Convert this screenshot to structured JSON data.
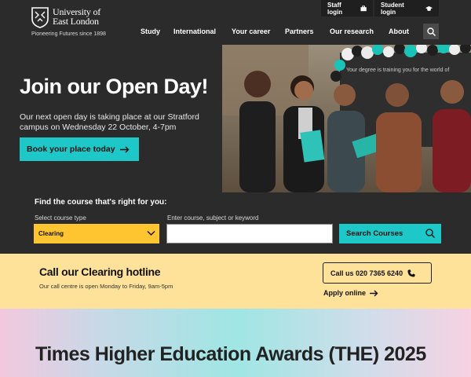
{
  "header": {
    "logo_text_line1": "University of",
    "logo_text_line2": "East London",
    "tagline": "Pioneering Futures since 1898",
    "staff_login": "Staff login",
    "student_login": "Student login",
    "nav": [
      "Study",
      "International",
      "Your career",
      "Partners",
      "Our research",
      "About"
    ]
  },
  "hero": {
    "title": "Join our Open Day!",
    "description": "Our next open day is taking place at our Stratford campus on Wednesday 22 October, 4-7pm",
    "button": "Book your place today",
    "photo_sign": "Your degree is training you for the world of"
  },
  "finder": {
    "title": "Find the course that's right for you:",
    "select_label": "Select course type",
    "select_value": "Clearing",
    "keyword_label": "Enter course, subject or keyword",
    "keyword_value": "",
    "search_button": "Search Courses"
  },
  "clearing": {
    "title": "Call our Clearing hotline",
    "subtitle": "Our call centre is open Monday to Friday, 9am-5pm",
    "call_button": "Call us 020 7365 6240",
    "apply_link": "Apply online"
  },
  "awards": {
    "title": "Times Higher Education Awards (THE) 2025"
  },
  "colors": {
    "background": "#2b2b2b",
    "accent_teal": "#1ec8c8",
    "select_yellow": "#ffc530",
    "clearing_band": "#ffe29a"
  }
}
